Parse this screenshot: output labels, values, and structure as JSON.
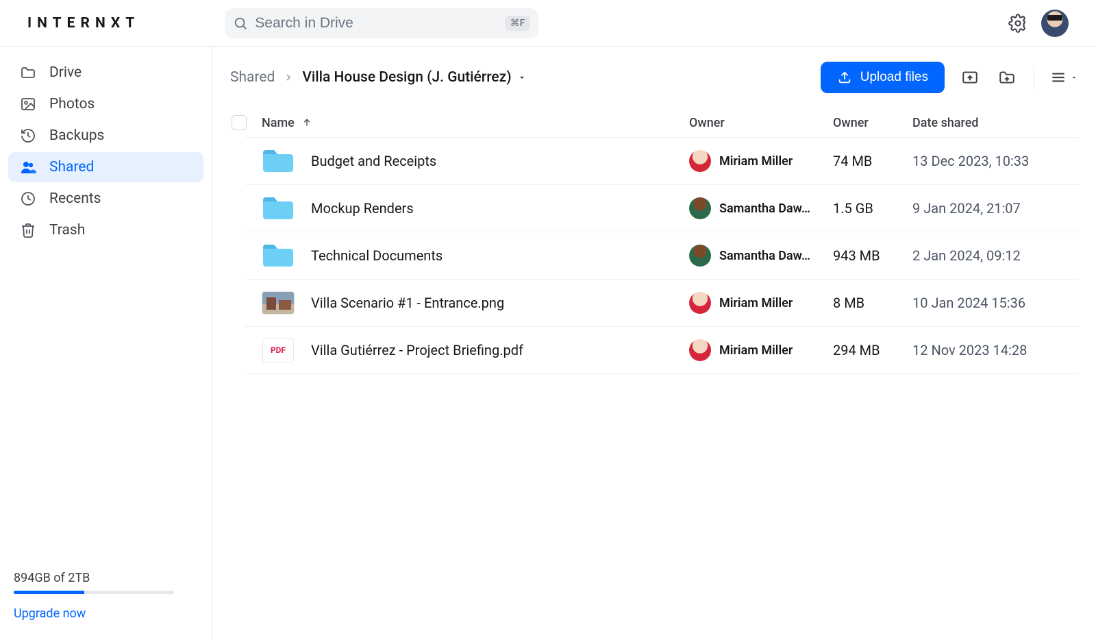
{
  "brand": "INTERNXT",
  "search": {
    "placeholder": "Search in Drive",
    "shortcut": "⌘F"
  },
  "sidebar": {
    "items": [
      {
        "label": "Drive",
        "icon": "folder"
      },
      {
        "label": "Photos",
        "icon": "image"
      },
      {
        "label": "Backups",
        "icon": "history"
      },
      {
        "label": "Shared",
        "icon": "people",
        "active": true
      },
      {
        "label": "Recents",
        "icon": "clock"
      },
      {
        "label": "Trash",
        "icon": "trash"
      }
    ]
  },
  "storage": {
    "text": "894GB of 2TB",
    "upgrade": "Upgrade now",
    "percent": 44
  },
  "breadcrumb": {
    "root": "Shared",
    "current": "Villa House Design (J. Gutiérrez)"
  },
  "toolbar": {
    "upload": "Upload files"
  },
  "columns": {
    "name": "Name",
    "owner1": "Owner",
    "owner2": "Owner",
    "date": "Date shared"
  },
  "rows": [
    {
      "type": "folder",
      "name": "Budget and Receipts",
      "owner": "Miriam Miller",
      "owner_avatar": "m",
      "size": "74 MB",
      "date": "13 Dec 2023, 10:33"
    },
    {
      "type": "folder",
      "name": "Mockup Renders",
      "owner": "Samantha Daw…",
      "owner_avatar": "s",
      "size": "1.5 GB",
      "date": "9 Jan 2024, 21:07"
    },
    {
      "type": "folder",
      "name": "Technical Documents",
      "owner": "Samantha Daw…",
      "owner_avatar": "s",
      "size": "943 MB",
      "date": "2 Jan 2024, 09:12"
    },
    {
      "type": "png",
      "name": "Villa Scenario #1 - Entrance.png",
      "owner": "Miriam Miller",
      "owner_avatar": "m",
      "size": "8 MB",
      "date": "10 Jan 2024 15:36"
    },
    {
      "type": "pdf",
      "name": "Villa Gutiérrez - Project Briefing.pdf",
      "owner": "Miriam Miller",
      "owner_avatar": "m",
      "size": "294 MB",
      "date": "12 Nov 2023 14:28"
    }
  ],
  "icons": {
    "pdf_label": "PDF"
  }
}
